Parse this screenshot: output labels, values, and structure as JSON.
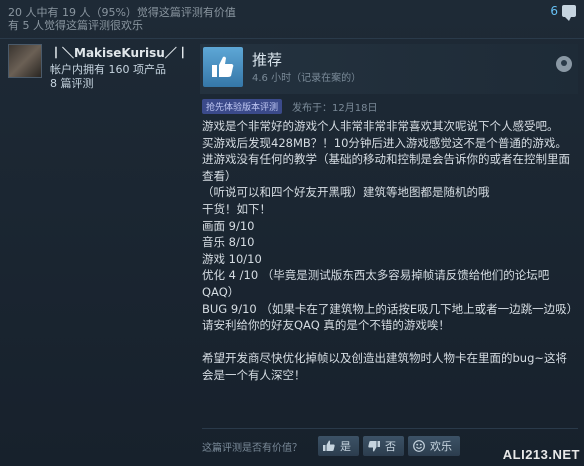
{
  "header": {
    "helpful_line": "20 人中有 19 人（95%）觉得这篇评测有价值",
    "funny_line": "有 5 人觉得这篇评测很欢乐",
    "comment_count": "6"
  },
  "author": {
    "name": "丨＼MakiseKurisu／丨",
    "products": "帐户内拥有 160 项产品",
    "reviews": "8 篇评测"
  },
  "review": {
    "verdict": "推荐",
    "hours": "4.6 小时（记录在案的）",
    "early_access_badge": "抢先体验版本评测",
    "posted": "发布于：12月18日",
    "body": [
      "游戏是个非常好的游戏个人非常非常非常喜欢其次呢说下个人感受吧。",
      "买游戏后发现428MB？！10分钟后进入游戏感觉这不是个普通的游戏。",
      "进游戏没有任何的教学（基础的移动和控制是会告诉你的或者在控制里面查看）",
      "（听说可以和四个好友开黑哦）建筑等地图都是随机的哦",
      "干货！如下！",
      "画面 9/10",
      "音乐 8/10",
      "游戏 10/10",
      "优化 4 /10 （毕竟是测试版东西太多容易掉帧请反馈给他们的论坛吧QAQ）",
      "BUG 9/10 （如果卡在了建筑物上的话按E吸几下地上或者一边跳一边吸）",
      "请安利给你的好友QAQ 真的是个不错的游戏唉！"
    ],
    "closing": "希望开发商尽快优化掉帧以及创造出建筑物时人物卡在里面的bug~这将会是一个有人深空！"
  },
  "votes": {
    "question": "这篇评测是否有价值？",
    "yes": "是",
    "no": "否",
    "funny": "欢乐"
  },
  "watermark": "ALI213.NET",
  "colors": {
    "background": "#1b2838",
    "link": "#66c0f4",
    "thumb_tile": "#4a90c4",
    "early_badge": "#3b4a8a"
  }
}
